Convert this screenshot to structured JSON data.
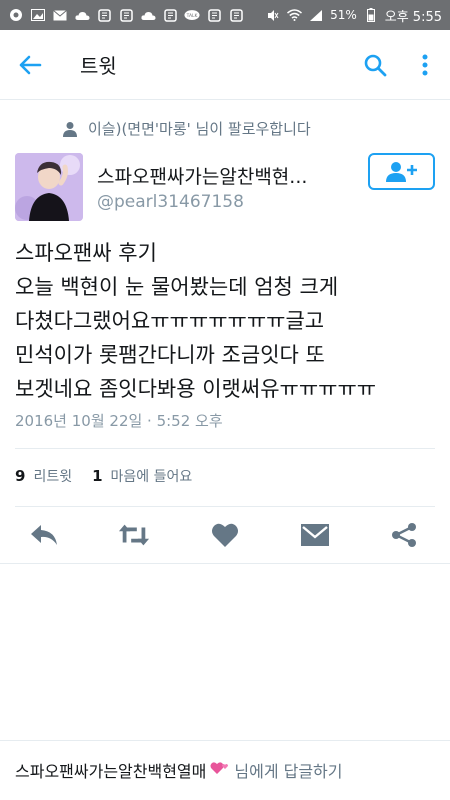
{
  "status_bar": {
    "left_icons": [
      "message-icon",
      "photo-icon",
      "mail-icon",
      "cloud-icon",
      "app-icon",
      "app-icon",
      "cloud-icon",
      "app-icon",
      "talk-icon",
      "app-icon",
      "app-icon"
    ],
    "talk_badge": "TALK",
    "battery": "51%",
    "time": "오후 5:55"
  },
  "appbar": {
    "title": "트윗"
  },
  "context": {
    "text": "이슬)(면면'마롱' 님이 팔로우합니다"
  },
  "tweet": {
    "display_name": "스파오팬싸가는알찬백현...",
    "handle": "@pearl31467158",
    "lines": [
      "스파오팬싸 후기",
      "오늘 백현이 눈 물어봤는데 엄청 크게",
      "다쳤다그랬어요ㅠㅠㅠㅠㅠㅠㅠ글고",
      "민석이가 롯팸간다니까 조금잇다 또",
      "보겟네요 좀잇다봐용 이랫써유ㅠㅠㅠㅠㅠ"
    ],
    "timestamp": "2016년 10월 22일 · 5:52 오후",
    "retweets": "9",
    "retweets_label": "리트윗",
    "likes": "1",
    "likes_label": "마음에 들어요"
  },
  "reply": {
    "name": "스파오팬싸가는알찬백현열매",
    "suffix": "님에게 답글하기"
  },
  "colors": {
    "accent": "#1da1f2",
    "icon_gray": "#657786",
    "status_bar": "#6d6f72"
  }
}
